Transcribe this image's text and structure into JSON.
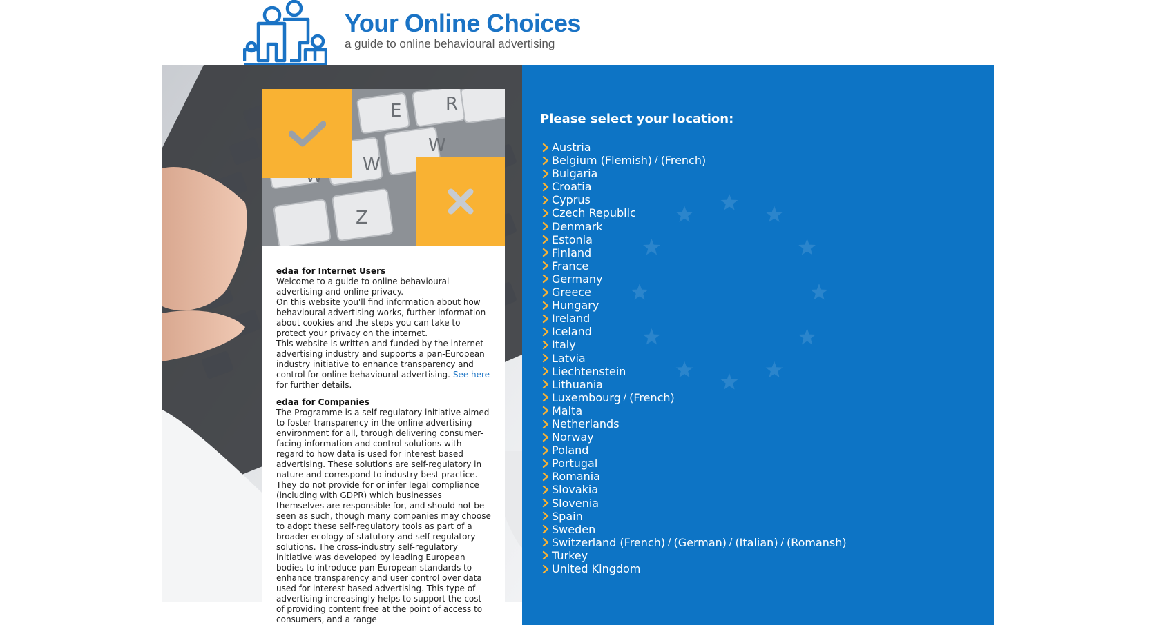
{
  "header": {
    "title": "Your Online Choices",
    "subtitle": "a guide to online behavioural advertising"
  },
  "card": {
    "users_heading": "edaa for Internet Users",
    "users_p1": "Welcome to a guide to online behavioural advertising and online privacy.",
    "users_p2": "On this website you'll find information about how behavioural advertising works, further information about cookies and the steps you can take to protect your privacy on the internet.",
    "users_p3": "This website is written and funded by the internet advertising industry and supports a pan-European industry initiative to enhance transparency and control for online behavioural advertising.",
    "see_here": "See here",
    "further_details": " for further details.",
    "companies_heading": "edaa for Companies",
    "companies_body": "The Programme is a self-regulatory initiative aimed to foster transparency in the online advertising environment for all, through delivering consumer-facing information and control solutions with regard to how data is used for interest based advertising. These solutions are self-regulatory in nature and correspond to industry best practice. They do not provide for or infer legal compliance (including with GDPR) which businesses themselves are responsible for, and should not be seen as such, though many companies may choose to adopt these self-regulatory tools as part of a broader ecology of statutory and self-regulatory solutions. The cross-industry self-regulatory initiative was developed by leading European bodies to introduce pan-European standards to enhance transparency and user control over data used for interest based advertising. This type of advertising increasingly helps to support the cost of providing content free at the point of access to consumers, and a range"
  },
  "location": {
    "title": "Please select your location:",
    "countries": [
      {
        "name": "Austria"
      },
      {
        "name": "Belgium (Flemish)",
        "alt": [
          "(French)"
        ]
      },
      {
        "name": "Bulgaria"
      },
      {
        "name": "Croatia"
      },
      {
        "name": "Cyprus"
      },
      {
        "name": "Czech Republic"
      },
      {
        "name": "Denmark"
      },
      {
        "name": "Estonia"
      },
      {
        "name": "Finland"
      },
      {
        "name": "France"
      },
      {
        "name": "Germany"
      },
      {
        "name": "Greece"
      },
      {
        "name": "Hungary"
      },
      {
        "name": "Ireland"
      },
      {
        "name": "Iceland"
      },
      {
        "name": "Italy"
      },
      {
        "name": "Latvia"
      },
      {
        "name": "Liechtenstein"
      },
      {
        "name": "Lithuania"
      },
      {
        "name": "Luxembourg",
        "alt": [
          "(French)"
        ]
      },
      {
        "name": "Malta"
      },
      {
        "name": "Netherlands"
      },
      {
        "name": "Norway"
      },
      {
        "name": "Poland"
      },
      {
        "name": "Portugal"
      },
      {
        "name": "Romania"
      },
      {
        "name": "Slovakia"
      },
      {
        "name": "Slovenia"
      },
      {
        "name": "Spain"
      },
      {
        "name": "Sweden"
      },
      {
        "name": "Switzerland (French)",
        "alt": [
          "(German)",
          "(Italian)",
          "(Romansh)"
        ]
      },
      {
        "name": "Turkey"
      },
      {
        "name": "United Kingdom"
      }
    ]
  },
  "colors": {
    "brand_blue": "#0d74c5",
    "accent_orange": "#f9b233",
    "title_blue": "#1a73c5"
  },
  "icons": [
    "logo-family-icon",
    "checkmark-icon",
    "cross-icon",
    "chevron-right-icon",
    "eu-stars-icon"
  ]
}
